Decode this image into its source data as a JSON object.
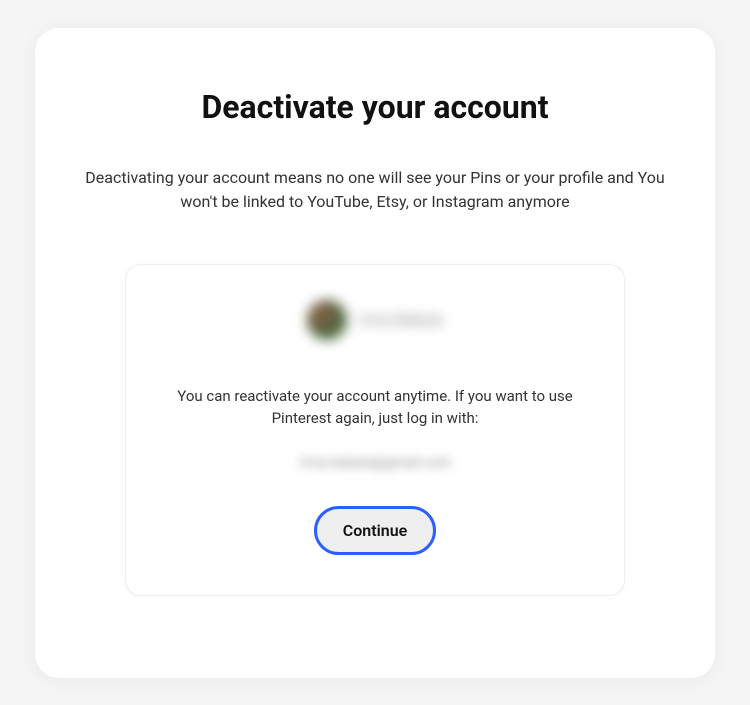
{
  "modal": {
    "title": "Deactivate your account",
    "description": "Deactivating your account means no one will see your Pins or your profile and You won't be linked to YouTube, Etsy, or Instagram anymore"
  },
  "profile": {
    "username": "Irma Bakyte",
    "reactivate_text": "You can reactivate your account anytime. If you want to use Pinterest again, just log in with:",
    "email": "irma.bakyte@gmail.com"
  },
  "actions": {
    "continue_label": "Continue"
  }
}
